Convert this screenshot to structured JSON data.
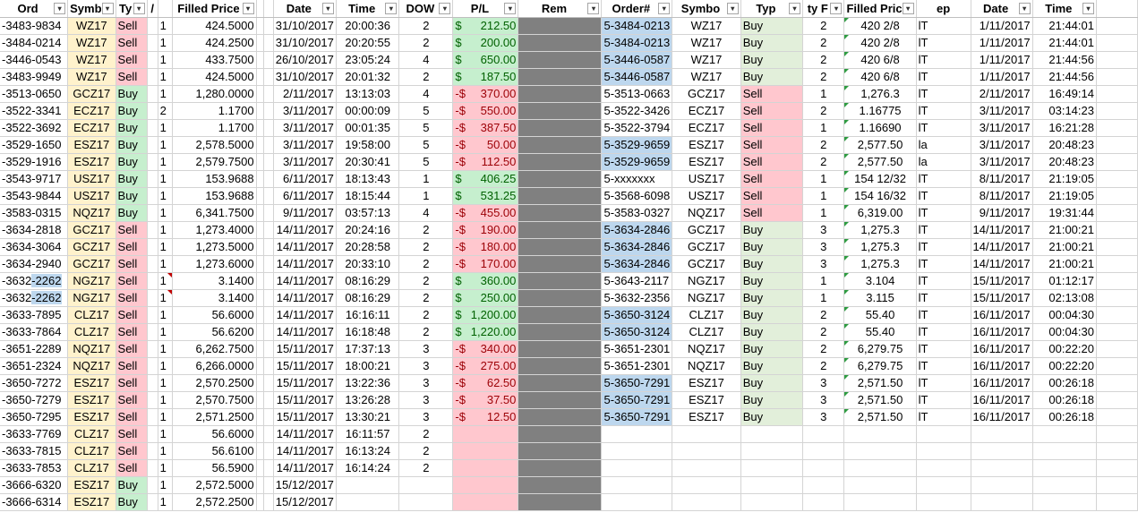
{
  "headers_left": [
    "Ord",
    "Symb",
    "Ty",
    "/",
    "Filled Price",
    "",
    "Date",
    "Time",
    "DOW",
    "P/L",
    "Rem"
  ],
  "headers_right": [
    "Order#",
    "Symbo",
    "Typ",
    "ty F",
    "Filled Pric",
    "ep",
    "Date",
    "Time"
  ],
  "left_rows": [
    {
      "order": "-3483-9834",
      "sym": "WZ17",
      "type": "Sell",
      "qty": "1",
      "price": "424.5000",
      "date": "31/10/2017",
      "time": "20:00:36",
      "dow": "2",
      "pl_sign": "$",
      "pl": "212.50"
    },
    {
      "order": "-3484-0214",
      "sym": "WZ17",
      "type": "Sell",
      "qty": "1",
      "price": "424.2500",
      "date": "31/10/2017",
      "time": "20:20:55",
      "dow": "2",
      "pl_sign": "$",
      "pl": "200.00"
    },
    {
      "order": "-3446-0543",
      "sym": "WZ17",
      "type": "Sell",
      "qty": "1",
      "price": "433.7500",
      "date": "26/10/2017",
      "time": "23:05:24",
      "dow": "4",
      "pl_sign": "$",
      "pl": "650.00"
    },
    {
      "order": "-3483-9949",
      "sym": "WZ17",
      "type": "Sell",
      "qty": "1",
      "price": "424.5000",
      "date": "31/10/2017",
      "time": "20:01:32",
      "dow": "2",
      "pl_sign": "$",
      "pl": "187.50"
    },
    {
      "order": "-3513-0650",
      "sym": "GCZ17",
      "type": "Buy",
      "qty": "1",
      "price": "1,280.0000",
      "date": "2/11/2017",
      "time": "13:13:03",
      "dow": "4",
      "pl_sign": "-$",
      "pl": "370.00"
    },
    {
      "order": "-3522-3341",
      "sym": "ECZ17",
      "type": "Buy",
      "qty": "2",
      "price": "1.1700",
      "date": "3/11/2017",
      "time": "00:00:09",
      "dow": "5",
      "pl_sign": "-$",
      "pl": "550.00"
    },
    {
      "order": "-3522-3692",
      "sym": "ECZ17",
      "type": "Buy",
      "qty": "1",
      "price": "1.1700",
      "date": "3/11/2017",
      "time": "00:01:35",
      "dow": "5",
      "pl_sign": "-$",
      "pl": "387.50"
    },
    {
      "order": "-3529-1650",
      "sym": "ESZ17",
      "type": "Buy",
      "qty": "1",
      "price": "2,578.5000",
      "date": "3/11/2017",
      "time": "19:58:00",
      "dow": "5",
      "pl_sign": "-$",
      "pl": "50.00"
    },
    {
      "order": "-3529-1916",
      "sym": "ESZ17",
      "type": "Buy",
      "qty": "1",
      "price": "2,579.7500",
      "date": "3/11/2017",
      "time": "20:30:41",
      "dow": "5",
      "pl_sign": "-$",
      "pl": "112.50"
    },
    {
      "order": "-3543-9717",
      "sym": "USZ17",
      "type": "Buy",
      "qty": "1",
      "price": "153.9688",
      "date": "6/11/2017",
      "time": "18:13:43",
      "dow": "1",
      "pl_sign": "$",
      "pl": "406.25"
    },
    {
      "order": "-3543-9844",
      "sym": "USZ17",
      "type": "Buy",
      "qty": "1",
      "price": "153.9688",
      "date": "6/11/2017",
      "time": "18:15:44",
      "dow": "1",
      "pl_sign": "$",
      "pl": "531.25"
    },
    {
      "order": "-3583-0315",
      "sym": "NQZ17",
      "type": "Buy",
      "qty": "1",
      "price": "6,341.7500",
      "date": "9/11/2017",
      "time": "03:57:13",
      "dow": "4",
      "pl_sign": "-$",
      "pl": "455.00"
    },
    {
      "order": "-3634-2818",
      "sym": "GCZ17",
      "type": "Sell",
      "qty": "1",
      "price": "1,273.4000",
      "date": "14/11/2017",
      "time": "20:24:16",
      "dow": "2",
      "pl_sign": "-$",
      "pl": "190.00"
    },
    {
      "order": "-3634-3064",
      "sym": "GCZ17",
      "type": "Sell",
      "qty": "1",
      "price": "1,273.5000",
      "date": "14/11/2017",
      "time": "20:28:58",
      "dow": "2",
      "pl_sign": "-$",
      "pl": "180.00"
    },
    {
      "order": "-3634-2940",
      "sym": "GCZ17",
      "type": "Sell",
      "qty": "1",
      "price": "1,273.6000",
      "date": "14/11/2017",
      "time": "20:33:10",
      "dow": "2",
      "pl_sign": "-$",
      "pl": "170.00"
    },
    {
      "order": "-3632-2262",
      "sym": "NGZ17",
      "type": "Sell",
      "qty": "1",
      "price": "3.1400",
      "date": "14/11/2017",
      "time": "08:16:29",
      "dow": "2",
      "pl_sign": "$",
      "pl": "360.00"
    },
    {
      "order": "-3632-2262",
      "sym": "NGZ17",
      "type": "Sell",
      "qty": "1",
      "price": "3.1400",
      "date": "14/11/2017",
      "time": "08:16:29",
      "dow": "2",
      "pl_sign": "$",
      "pl": "250.00"
    },
    {
      "order": "-3633-7895",
      "sym": "CLZ17",
      "type": "Sell",
      "qty": "1",
      "price": "56.6000",
      "date": "14/11/2017",
      "time": "16:16:11",
      "dow": "2",
      "pl_sign": "$",
      "pl": "1,200.00"
    },
    {
      "order": "-3633-7864",
      "sym": "CLZ17",
      "type": "Sell",
      "qty": "1",
      "price": "56.6200",
      "date": "14/11/2017",
      "time": "16:18:48",
      "dow": "2",
      "pl_sign": "$",
      "pl": "1,220.00"
    },
    {
      "order": "-3651-2289",
      "sym": "NQZ17",
      "type": "Sell",
      "qty": "1",
      "price": "6,262.7500",
      "date": "15/11/2017",
      "time": "17:37:13",
      "dow": "3",
      "pl_sign": "-$",
      "pl": "340.00"
    },
    {
      "order": "-3651-2324",
      "sym": "NQZ17",
      "type": "Sell",
      "qty": "1",
      "price": "6,266.0000",
      "date": "15/11/2017",
      "time": "18:00:21",
      "dow": "3",
      "pl_sign": "-$",
      "pl": "275.00"
    },
    {
      "order": "-3650-7272",
      "sym": "ESZ17",
      "type": "Sell",
      "qty": "1",
      "price": "2,570.2500",
      "date": "15/11/2017",
      "time": "13:22:36",
      "dow": "3",
      "pl_sign": "-$",
      "pl": "62.50"
    },
    {
      "order": "-3650-7279",
      "sym": "ESZ17",
      "type": "Sell",
      "qty": "1",
      "price": "2,570.7500",
      "date": "15/11/2017",
      "time": "13:26:28",
      "dow": "3",
      "pl_sign": "-$",
      "pl": "37.50"
    },
    {
      "order": "-3650-7295",
      "sym": "ESZ17",
      "type": "Sell",
      "qty": "1",
      "price": "2,571.2500",
      "date": "15/11/2017",
      "time": "13:30:21",
      "dow": "3",
      "pl_sign": "-$",
      "pl": "12.50"
    },
    {
      "order": "-3633-7769",
      "sym": "CLZ17",
      "type": "Sell",
      "qty": "1",
      "price": "56.6000",
      "date": "14/11/2017",
      "time": "16:11:57",
      "dow": "2",
      "pl_sign": "",
      "pl": ""
    },
    {
      "order": "-3633-7815",
      "sym": "CLZ17",
      "type": "Sell",
      "qty": "1",
      "price": "56.6100",
      "date": "14/11/2017",
      "time": "16:13:24",
      "dow": "2",
      "pl_sign": "",
      "pl": ""
    },
    {
      "order": "-3633-7853",
      "sym": "CLZ17",
      "type": "Sell",
      "qty": "1",
      "price": "56.5900",
      "date": "14/11/2017",
      "time": "16:14:24",
      "dow": "2",
      "pl_sign": "",
      "pl": ""
    },
    {
      "order": "-3666-6320",
      "sym": "ESZ17",
      "type": "Buy",
      "qty": "1",
      "price": "2,572.5000",
      "date": "15/12/2017",
      "time": "",
      "dow": "",
      "pl_sign": "",
      "pl": ""
    },
    {
      "order": "-3666-6314",
      "sym": "ESZ17",
      "type": "Buy",
      "qty": "1",
      "price": "2,572.2500",
      "date": "15/12/2017",
      "time": "",
      "dow": "",
      "pl_sign": "",
      "pl": ""
    }
  ],
  "right_rows": [
    {
      "order": "5-3484-0213",
      "sym": "WZ17",
      "type": "Buy",
      "qty": "2",
      "price": "420 2/8",
      "ex": "lT",
      "date": "1/11/2017",
      "time": "21:44:01"
    },
    {
      "order": "5-3484-0213",
      "sym": "WZ17",
      "type": "Buy",
      "qty": "2",
      "price": "420 2/8",
      "ex": "lT",
      "date": "1/11/2017",
      "time": "21:44:01"
    },
    {
      "order": "5-3446-0587",
      "sym": "WZ17",
      "type": "Buy",
      "qty": "2",
      "price": "420 6/8",
      "ex": "lT",
      "date": "1/11/2017",
      "time": "21:44:56"
    },
    {
      "order": "5-3446-0587",
      "sym": "WZ17",
      "type": "Buy",
      "qty": "2",
      "price": "420 6/8",
      "ex": "lT",
      "date": "1/11/2017",
      "time": "21:44:56"
    },
    {
      "order": "5-3513-0663",
      "sym": "GCZ17",
      "type": "Sell",
      "qty": "1",
      "price": "1,276.3",
      "ex": "lT",
      "date": "2/11/2017",
      "time": "16:49:14"
    },
    {
      "order": "5-3522-3426",
      "sym": "ECZ17",
      "type": "Sell",
      "qty": "2",
      "price": "1.16775",
      "ex": "lT",
      "date": "3/11/2017",
      "time": "03:14:23"
    },
    {
      "order": "5-3522-3794",
      "sym": "ECZ17",
      "type": "Sell",
      "qty": "1",
      "price": "1.16690",
      "ex": "lT",
      "date": "3/11/2017",
      "time": "16:21:28"
    },
    {
      "order": "5-3529-9659",
      "sym": "ESZ17",
      "type": "Sell",
      "qty": "2",
      "price": "2,577.50",
      "ex": "la",
      "date": "3/11/2017",
      "time": "20:48:23"
    },
    {
      "order": "5-3529-9659",
      "sym": "ESZ17",
      "type": "Sell",
      "qty": "2",
      "price": "2,577.50",
      "ex": "la",
      "date": "3/11/2017",
      "time": "20:48:23"
    },
    {
      "order": "5-xxxxxxx",
      "sym": "USZ17",
      "type": "Sell",
      "qty": "1",
      "price": "154 12/32",
      "ex": "lT",
      "date": "8/11/2017",
      "time": "21:19:05"
    },
    {
      "order": "5-3568-6098",
      "sym": "USZ17",
      "type": "Sell",
      "qty": "1",
      "price": "154 16/32",
      "ex": "lT",
      "date": "8/11/2017",
      "time": "21:19:05"
    },
    {
      "order": "5-3583-0327",
      "sym": "NQZ17",
      "type": "Sell",
      "qty": "1",
      "price": "6,319.00",
      "ex": "lT",
      "date": "9/11/2017",
      "time": "19:31:44"
    },
    {
      "order": "5-3634-2846",
      "sym": "GCZ17",
      "type": "Buy",
      "qty": "3",
      "price": "1,275.3",
      "ex": "lT",
      "date": "14/11/2017",
      "time": "21:00:21"
    },
    {
      "order": "5-3634-2846",
      "sym": "GCZ17",
      "type": "Buy",
      "qty": "3",
      "price": "1,275.3",
      "ex": "lT",
      "date": "14/11/2017",
      "time": "21:00:21"
    },
    {
      "order": "5-3634-2846",
      "sym": "GCZ17",
      "type": "Buy",
      "qty": "3",
      "price": "1,275.3",
      "ex": "lT",
      "date": "14/11/2017",
      "time": "21:00:21"
    },
    {
      "order": "5-3643-2117",
      "sym": "NGZ17",
      "type": "Buy",
      "qty": "1",
      "price": "3.104",
      "ex": "lT",
      "date": "15/11/2017",
      "time": "01:12:17"
    },
    {
      "order": "5-3632-2356",
      "sym": "NGZ17",
      "type": "Buy",
      "qty": "1",
      "price": "3.115",
      "ex": "lT",
      "date": "15/11/2017",
      "time": "02:13:08"
    },
    {
      "order": "5-3650-3124",
      "sym": "CLZ17",
      "type": "Buy",
      "qty": "2",
      "price": "55.40",
      "ex": "lT",
      "date": "16/11/2017",
      "time": "00:04:30"
    },
    {
      "order": "5-3650-3124",
      "sym": "CLZ17",
      "type": "Buy",
      "qty": "2",
      "price": "55.40",
      "ex": "lT",
      "date": "16/11/2017",
      "time": "00:04:30"
    },
    {
      "order": "5-3651-2301",
      "sym": "NQZ17",
      "type": "Buy",
      "qty": "2",
      "price": "6,279.75",
      "ex": "lT",
      "date": "16/11/2017",
      "time": "00:22:20"
    },
    {
      "order": "5-3651-2301",
      "sym": "NQZ17",
      "type": "Buy",
      "qty": "2",
      "price": "6,279.75",
      "ex": "lT",
      "date": "16/11/2017",
      "time": "00:22:20"
    },
    {
      "order": "5-3650-7291",
      "sym": "ESZ17",
      "type": "Buy",
      "qty": "3",
      "price": "2,571.50",
      "ex": "lT",
      "date": "16/11/2017",
      "time": "00:26:18"
    },
    {
      "order": "5-3650-7291",
      "sym": "ESZ17",
      "type": "Buy",
      "qty": "3",
      "price": "2,571.50",
      "ex": "lT",
      "date": "16/11/2017",
      "time": "00:26:18"
    },
    {
      "order": "5-3650-7291",
      "sym": "ESZ17",
      "type": "Buy",
      "qty": "3",
      "price": "2,571.50",
      "ex": "lT",
      "date": "16/11/2017",
      "time": "00:26:18"
    }
  ],
  "right_blue_rows": [
    0,
    1,
    2,
    3,
    7,
    8,
    12,
    13,
    14,
    17,
    18,
    21,
    22,
    23
  ],
  "colors": {
    "yellow": "#fff2cc",
    "pink": "#ffc7ce",
    "green": "#c6efce",
    "blue": "#bdd7ee",
    "light_green": "#e2efda",
    "gray": "#808080"
  }
}
